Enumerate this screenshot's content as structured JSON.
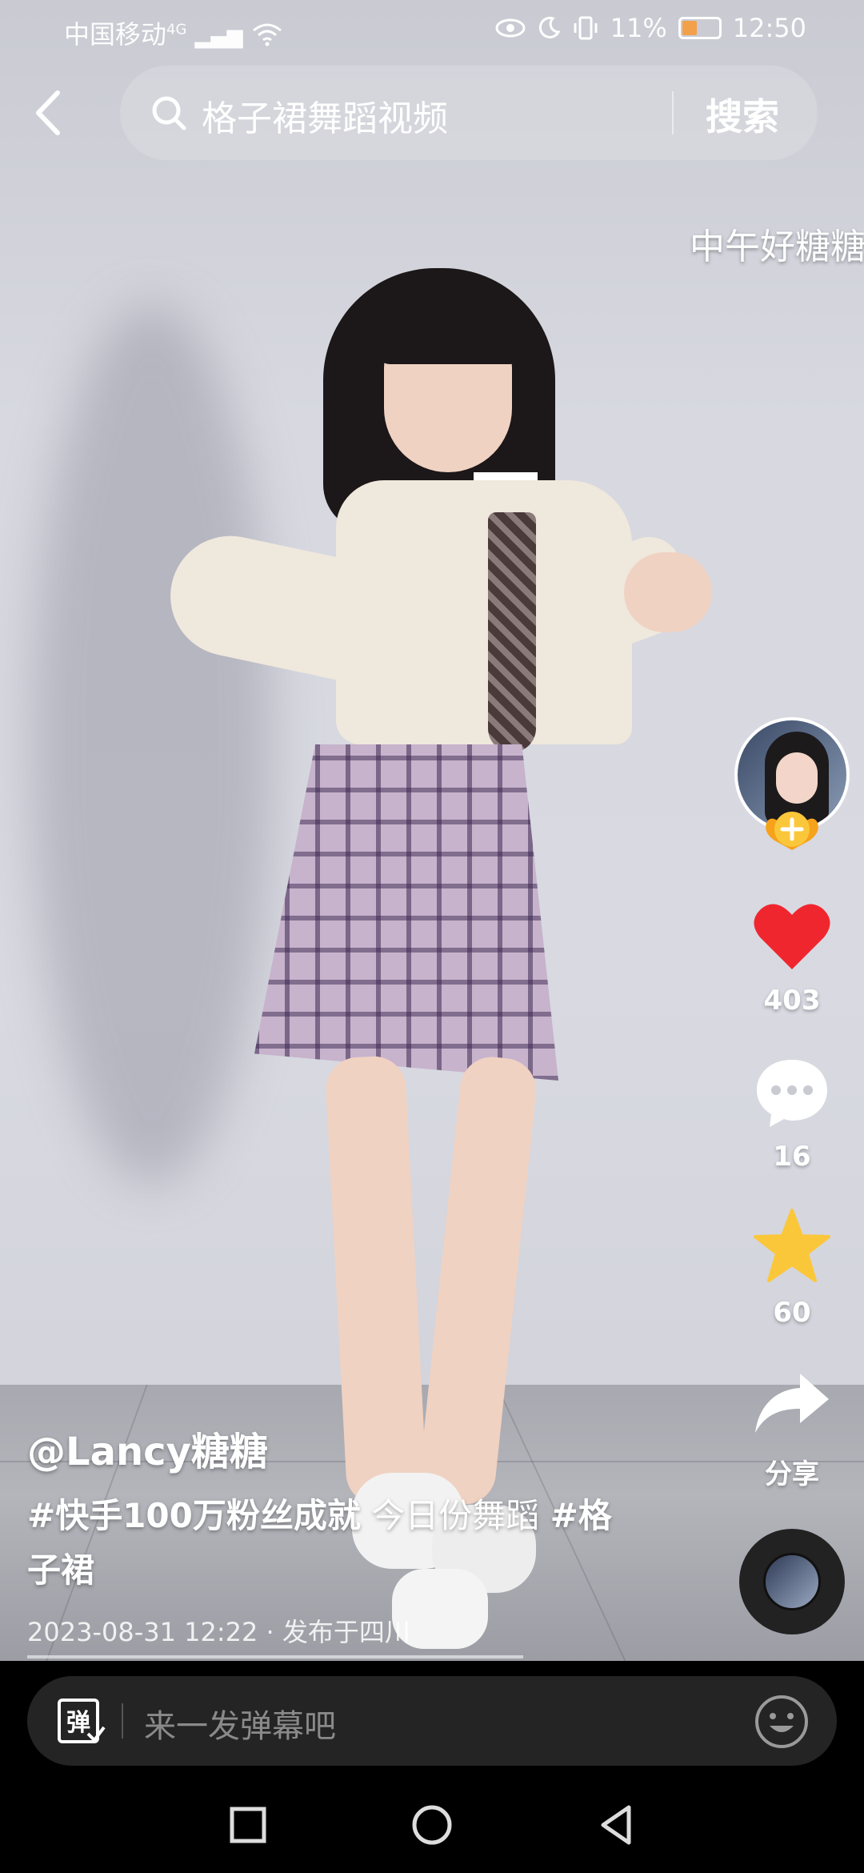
{
  "status_bar": {
    "carrier": "中国移动",
    "network": "4G",
    "battery_percent": "11%",
    "time": "12:50"
  },
  "search": {
    "query": "格子裙舞蹈视频",
    "button_label": "搜索"
  },
  "danmaku": {
    "overlay_text": "中午好糖糖"
  },
  "rail": {
    "likes": "403",
    "comments": "16",
    "favorites": "60",
    "share_label": "分享"
  },
  "video": {
    "author": "@Lancy糖糖",
    "caption_tag1": "#快手100万粉丝成就",
    "caption_text": " 今日份舞蹈 ",
    "caption_tag2": "#格子裙",
    "meta": "2023-08-31 12:22 · 发布于四川"
  },
  "input": {
    "danmu_icon_label": "弹",
    "placeholder": "来一发弹幕吧"
  },
  "colors": {
    "like_red": "#f0262f",
    "favorite_yellow": "#fbc73a",
    "follow_orange": "#f7a21b"
  },
  "icons": [
    "back-arrow-icon",
    "search-icon",
    "heart-icon",
    "comment-icon",
    "star-icon",
    "share-icon",
    "music-disc",
    "emoji-icon",
    "square-nav-icon",
    "circle-nav-icon",
    "triangle-nav-icon"
  ]
}
